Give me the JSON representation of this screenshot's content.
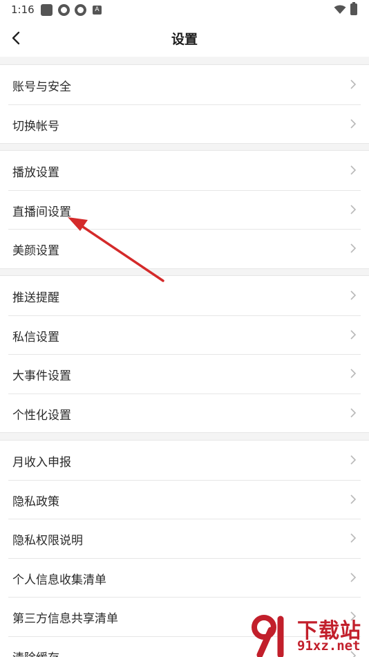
{
  "status_bar": {
    "time": "1:16",
    "notification_a": "A"
  },
  "header": {
    "title": "设置"
  },
  "groups": [
    {
      "items": [
        {
          "label": "账号与安全"
        },
        {
          "label": "切换帐号"
        }
      ]
    },
    {
      "items": [
        {
          "label": "播放设置"
        },
        {
          "label": "直播间设置"
        },
        {
          "label": "美颜设置"
        }
      ]
    },
    {
      "items": [
        {
          "label": "推送提醒"
        },
        {
          "label": "私信设置"
        },
        {
          "label": "大事件设置"
        },
        {
          "label": "个性化设置"
        }
      ]
    },
    {
      "items": [
        {
          "label": "月收入申报"
        },
        {
          "label": "隐私政策"
        },
        {
          "label": "隐私权限说明"
        },
        {
          "label": "个人信息收集清单"
        },
        {
          "label": "第三方信息共享清单"
        },
        {
          "label": "清除缓存"
        }
      ]
    }
  ],
  "watermark": {
    "title": "下载站",
    "domain": "91xz.net"
  },
  "colors": {
    "annotation_arrow": "#d42a2a",
    "watermark": "#c21f2b"
  }
}
